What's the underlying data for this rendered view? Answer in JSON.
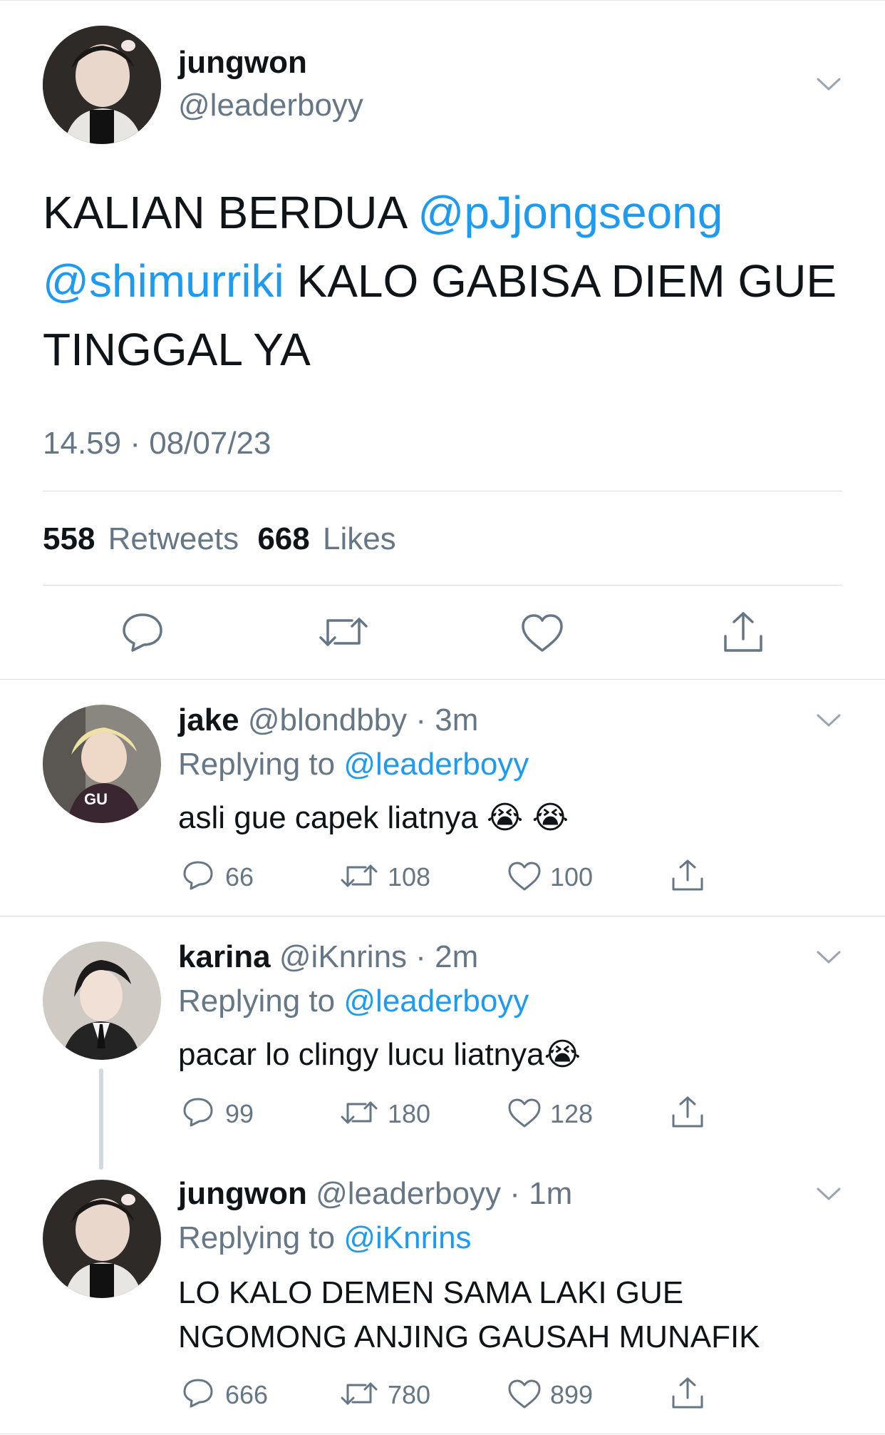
{
  "colors": {
    "link": "#1d9bf0",
    "muted": "#657786",
    "text": "#0f1419",
    "divider": "#dcdcdc"
  },
  "main_tweet": {
    "name": "jungwon",
    "handle": "@leaderboyy",
    "text_lines": [
      {
        "pre": "KALIAN BERDUA ",
        "mention": "@pJjongseong",
        "post": ""
      },
      {
        "pre": "",
        "mention": "@shimurriki",
        "post": " KALO GABISA DIEM GUE"
      },
      {
        "pre": "TINGGAL YA",
        "mention": "",
        "post": ""
      }
    ],
    "timestamp": "14.59 · 08/07/23",
    "retweets_count": "558",
    "retweets_label": "Retweets",
    "likes_count": "668",
    "likes_label": "Likes",
    "icons": [
      "reply-icon",
      "retweet-icon",
      "like-icon",
      "share-icon"
    ]
  },
  "replies": [
    {
      "name": "jake",
      "handle": "@blondbby",
      "time": "3m",
      "replying_label": "Replying to",
      "replying_to": "@leaderboyy",
      "text": "asli gue capek liatnya 😭 😭",
      "replies": "66",
      "retweets": "108",
      "likes": "100"
    },
    {
      "name": "karina",
      "handle": "@iKnrins",
      "time": "2m",
      "replying_label": "Replying to",
      "replying_to": "@leaderboyy",
      "text": "pacar lo clingy lucu liatnya😭",
      "replies": "99",
      "retweets": "180",
      "likes": "128"
    },
    {
      "name": "jungwon",
      "handle": "@leaderboyy",
      "time": "1m",
      "replying_label": "Replying to",
      "replying_to": "@iKnrins",
      "text_lines": [
        "LO KALO DEMEN SAMA LAKI GUE",
        "NGOMONG ANJING GAUSAH MUNAFIK"
      ],
      "replies": "666",
      "retweets": "780",
      "likes": "899"
    }
  ]
}
